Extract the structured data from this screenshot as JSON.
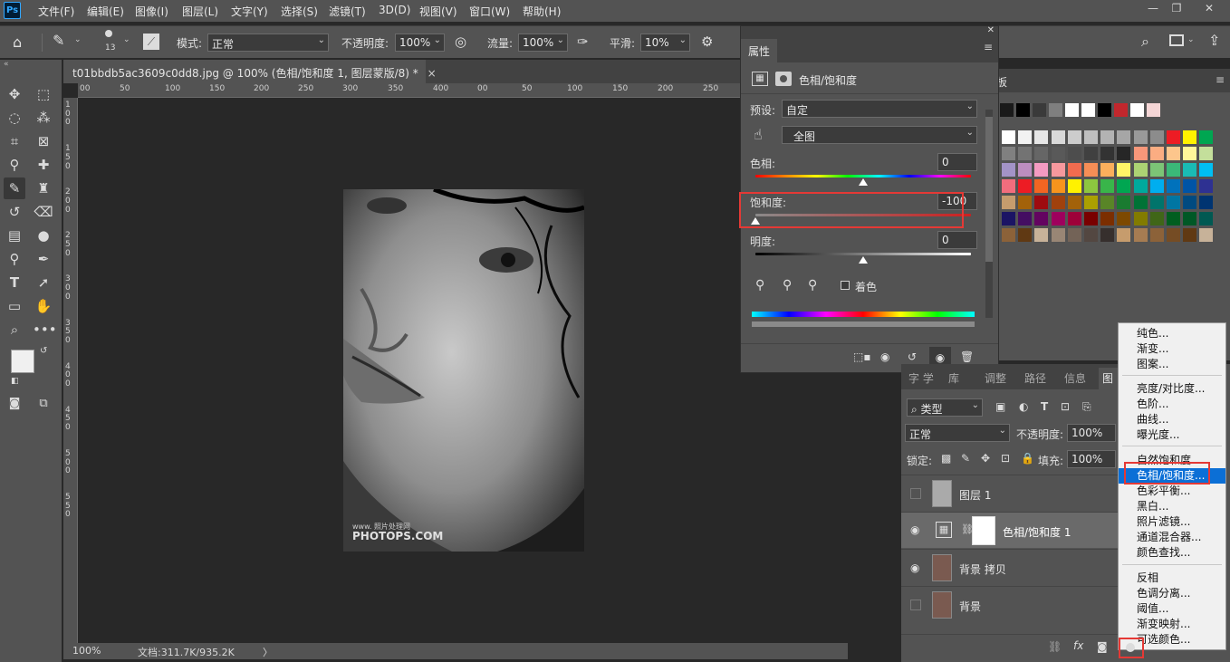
{
  "menubar": {
    "logo": "Ps",
    "items": [
      "文件(F)",
      "编辑(E)",
      "图像(I)",
      "图层(L)",
      "文字(Y)",
      "选择(S)",
      "滤镜(T)",
      "3D(D)",
      "视图(V)",
      "窗口(W)",
      "帮助(H)"
    ]
  },
  "options": {
    "brush_size": "13",
    "mode_label": "模式:",
    "mode_value": "正常",
    "opacity_label": "不透明度:",
    "opacity_value": "100%",
    "flow_label": "流量:",
    "flow_value": "100%",
    "smooth_label": "平滑:",
    "smooth_value": "10%"
  },
  "document": {
    "tab_title": "t01bbdb5ac3609c0dd8.jpg @ 100% (色相/饱和度 1, 图层蒙版/8) *",
    "close_glyph": "×",
    "watermark_small": "www.      照片处理网",
    "watermark_big": "PHOTOPS.COM",
    "ruler_h": [
      "00",
      "50",
      "100",
      "150",
      "200",
      "250",
      "300",
      "350",
      "400"
    ],
    "ruler_v": [
      "1",
      "0",
      "0",
      "1",
      "5",
      "0",
      "2",
      "0",
      "0",
      "2",
      "5",
      "0",
      "3",
      "0",
      "0",
      "3",
      "5",
      "0",
      "4",
      "0",
      "0",
      "4",
      "5",
      "0",
      "5",
      "0",
      "0",
      "5",
      "5",
      "0"
    ]
  },
  "status": {
    "zoom": "100%",
    "doc_size": "文档:311.7K/935.2K",
    "arrow": "〉"
  },
  "properties": {
    "panel_title": "属性",
    "adjustment_name": "色相/饱和度",
    "preset_label": "预设:",
    "preset_value": "自定",
    "channel_value": "全图",
    "hue_label": "色相:",
    "hue_value": "0",
    "saturation_label": "饱和度:",
    "saturation_value": "-100",
    "lightness_label": "明度:",
    "lightness_value": "0",
    "colorize_label": "着色",
    "levels": {
      "hue": 0.5,
      "saturation": 0.0,
      "lightness": 0.5
    }
  },
  "swatches": {
    "tab_label": "板",
    "row0": [
      "#1a1a1a",
      "#000000",
      "#3a3a3a",
      "#7f7f7f",
      "#ffffff",
      "#ffffff",
      "#000000",
      "#c1272d",
      "#ffffff",
      "#f5d6d6"
    ],
    "grid": [
      [
        "#ffffff",
        "#f2f2f2",
        "#e6e6e6",
        "#d9d9d9",
        "#cccccc",
        "#bfbfbf",
        "#b3b3b3",
        "#a6a6a6",
        "#999999",
        "#8c8c8c",
        "#ed1c24",
        "#fff200",
        "#00a651"
      ],
      [
        "#808080",
        "#737373",
        "#666666",
        "#595959",
        "#4d4d4d",
        "#404040",
        "#333333",
        "#262626",
        "#f7977a",
        "#fbad82",
        "#fdc68c",
        "#fff79a",
        "#c4df9b"
      ],
      [
        "#a393c7",
        "#bc8dbf",
        "#f49ac1",
        "#f6989d",
        "#f26c4f",
        "#f68e56",
        "#fbaf5c",
        "#fff467",
        "#acd373",
        "#7cc576",
        "#3bb878",
        "#1abbb4",
        "#00bff3"
      ],
      [
        "#f26d7d",
        "#ed1c24",
        "#f26522",
        "#f7941d",
        "#fff200",
        "#8dc63f",
        "#39b54a",
        "#00a651",
        "#00a99d",
        "#00aeef",
        "#0072bc",
        "#0054a6",
        "#2e3192"
      ],
      [
        "#c69c6d",
        "#a3620a",
        "#9e0b0f",
        "#a0410d",
        "#a36209",
        "#aba000",
        "#598527",
        "#1a7b30",
        "#007236",
        "#00746b",
        "#0076a3",
        "#004a80",
        "#003471"
      ],
      [
        "#1b1464",
        "#440e62",
        "#630460",
        "#9e005d",
        "#9e0039",
        "#790000",
        "#7b2e00",
        "#7d4900",
        "#827b00",
        "#406618",
        "#005e20",
        "#005826",
        "#005952"
      ],
      [
        "#8c6239",
        "#603913",
        "#c7b299",
        "#998675",
        "#736357",
        "#534741",
        "#362f2d",
        "#c69c6d",
        "#a67c52",
        "#8c6239",
        "#754c24",
        "#603913",
        "#c7b299"
      ]
    ]
  },
  "layers_panel": {
    "tabs": [
      "字 学",
      "库",
      "调整",
      "路径",
      "信息",
      "图"
    ],
    "filter_kind": "类型",
    "blend_mode": "正常",
    "opacity_label": "不透明度:",
    "opacity_value": "100%",
    "lock_label": "锁定:",
    "fill_label": "填充:",
    "fill_value": "100%",
    "layers": [
      {
        "name": "图层 1",
        "visible": false
      },
      {
        "name": "色相/饱和度 1",
        "visible": true
      },
      {
        "name": "背景 拷贝",
        "visible": true
      },
      {
        "name": "背景",
        "visible": false
      }
    ]
  },
  "context_menu": {
    "group1": [
      "纯色...",
      "渐变...",
      "图案..."
    ],
    "group2": [
      "亮度/对比度...",
      "色阶...",
      "曲线...",
      "曝光度..."
    ],
    "group3": [
      "自然饱和度...",
      "色相/饱和度...",
      "色彩平衡...",
      "黑白...",
      "照片滤镜...",
      "通道混合器...",
      "颜色查找..."
    ],
    "group4": [
      "反相",
      "色调分离...",
      "阈值...",
      "渐变映射...",
      "可选颜色..."
    ],
    "highlighted": "色相/饱和度..."
  },
  "colors": {
    "highlight_red": "#e53935",
    "menu_highlight": "#0b6fd6",
    "ui_panel": "#535353",
    "canvas_bg": "#282828"
  }
}
